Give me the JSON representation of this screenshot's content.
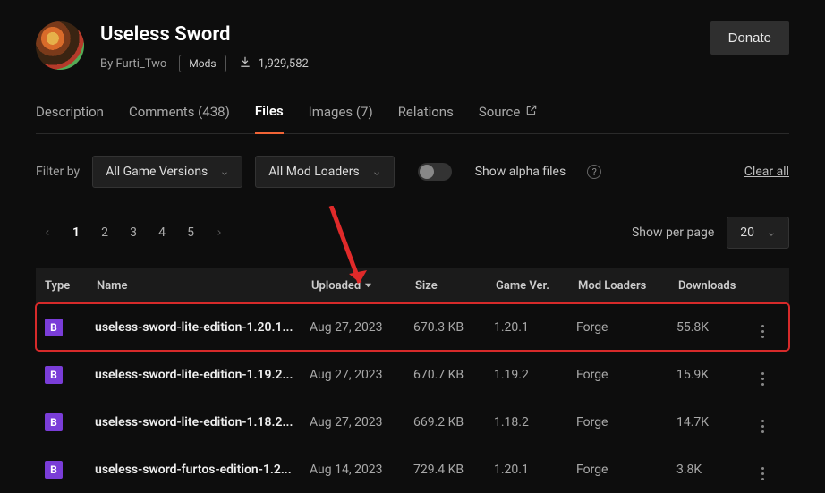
{
  "header": {
    "title": "Useless Sword",
    "by_prefix": "By",
    "author": "Furti_Two",
    "mod_badge": "Mods",
    "download_count": "1,929,582",
    "donate_label": "Donate"
  },
  "tabs": {
    "description": "Description",
    "comments": "Comments (438)",
    "files": "Files",
    "images": "Images (7)",
    "relations": "Relations",
    "source": "Source"
  },
  "filters": {
    "label": "Filter by",
    "game_versions": "All Game Versions",
    "mod_loaders": "All Mod Loaders",
    "alpha_label": "Show alpha files",
    "clear_all": "Clear all"
  },
  "pagination": {
    "pages": [
      "1",
      "2",
      "3",
      "4",
      "5"
    ],
    "current": "1",
    "per_page_label": "Show per page",
    "per_page_value": "20"
  },
  "table": {
    "headers": {
      "type": "Type",
      "name": "Name",
      "uploaded": "Uploaded",
      "size": "Size",
      "game_ver": "Game Ver.",
      "mod_loaders": "Mod Loaders",
      "downloads": "Downloads"
    },
    "rows": [
      {
        "type": "B",
        "name": "useless-sword-lite-edition-1.20.1...",
        "uploaded": "Aug 27, 2023",
        "size": "670.3 KB",
        "game_ver": "1.20.1",
        "mod_loaders": "Forge",
        "downloads": "55.8K",
        "highlight": true
      },
      {
        "type": "B",
        "name": "useless-sword-lite-edition-1.19.2...",
        "uploaded": "Aug 27, 2023",
        "size": "670.7 KB",
        "game_ver": "1.19.2",
        "mod_loaders": "Forge",
        "downloads": "15.9K",
        "highlight": false
      },
      {
        "type": "B",
        "name": "useless-sword-lite-edition-1.18.2...",
        "uploaded": "Aug 27, 2023",
        "size": "669.2 KB",
        "game_ver": "1.18.2",
        "mod_loaders": "Forge",
        "downloads": "14.7K",
        "highlight": false
      },
      {
        "type": "B",
        "name": "useless-sword-furtos-edition-1.2...",
        "uploaded": "Aug 14, 2023",
        "size": "729.4 KB",
        "game_ver": "1.20.1",
        "mod_loaders": "Forge",
        "downloads": "3.8K",
        "highlight": false
      }
    ]
  }
}
